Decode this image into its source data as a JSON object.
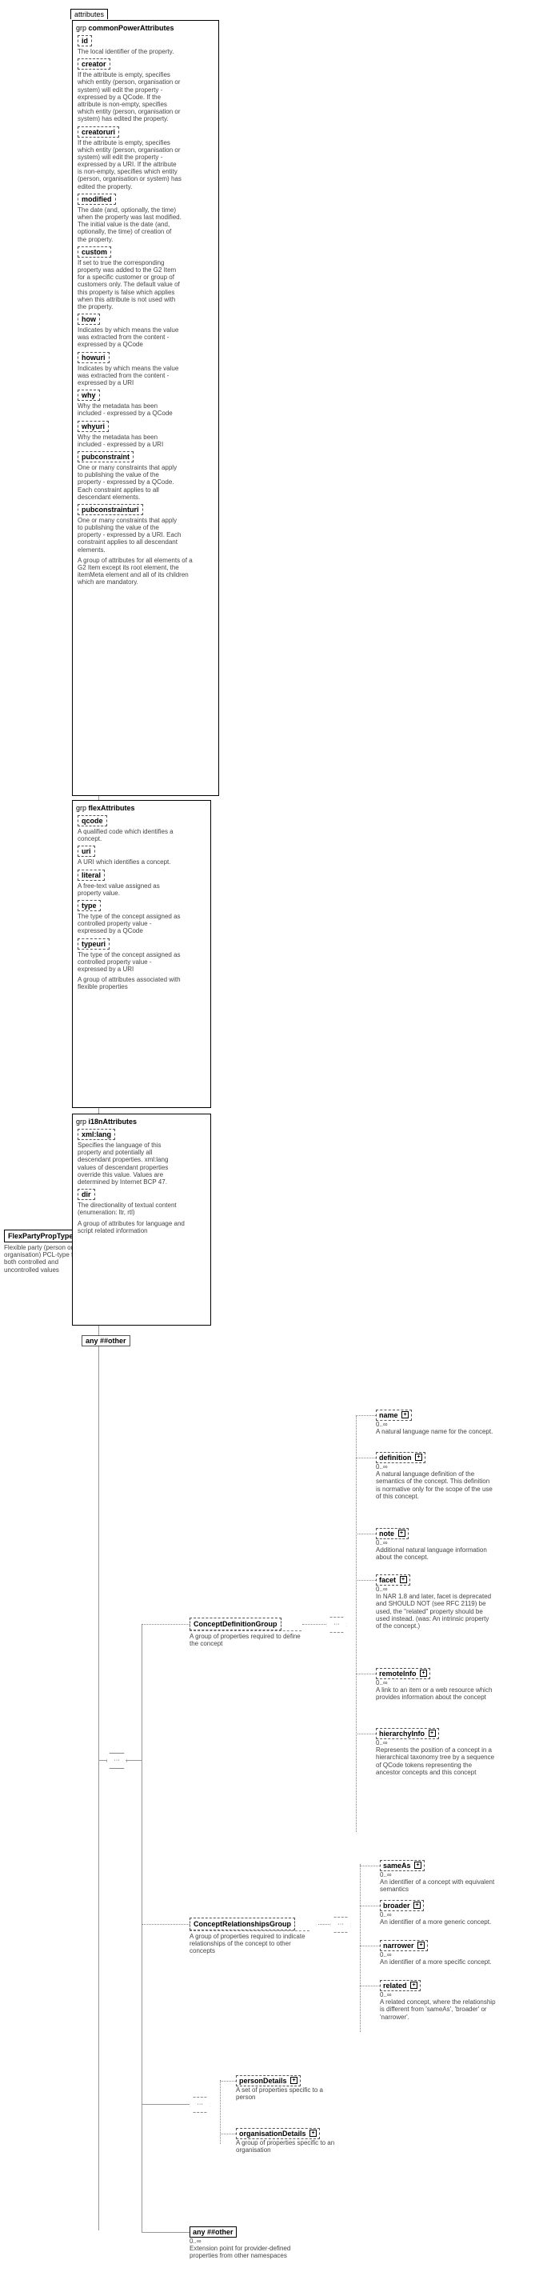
{
  "root": {
    "label": "FlexPartyPropType",
    "desc": "Flexible party (person or organisation) PCL-type for both controlled and uncontrolled values"
  },
  "attributes_tab": "attributes",
  "grp_prefix": "grp",
  "common": {
    "title": "commonPowerAttributes",
    "items": [
      {
        "name": "id",
        "desc": "The local identifier of the property."
      },
      {
        "name": "creator",
        "desc": "If the attribute is empty, specifies which entity (person, organisation or system) will edit the property - expressed by a QCode. If the attribute is non-empty, specifies which entity (person, organisation or system) has edited the property."
      },
      {
        "name": "creatoruri",
        "desc": "If the attribute is empty, specifies which entity (person, organisation or system) will edit the property - expressed by a URI. If the attribute is non-empty, specifies which entity (person, organisation or system) has edited the property."
      },
      {
        "name": "modified",
        "desc": "The date (and, optionally, the time) when the property was last modified. The initial value is the date (and, optionally, the time) of creation of the property."
      },
      {
        "name": "custom",
        "desc": "If set to true the corresponding property was added to the G2 Item for a specific customer or group of customers only. The default value of this property is false which applies when this attribute is not used with the property."
      },
      {
        "name": "how",
        "desc": "Indicates by which means the value was extracted from the content - expressed by a QCode"
      },
      {
        "name": "howuri",
        "desc": "Indicates by which means the value was extracted from the content - expressed by a URI"
      },
      {
        "name": "why",
        "desc": "Why the metadata has been included - expressed by a QCode"
      },
      {
        "name": "whyuri",
        "desc": "Why the metadata has been included - expressed by a URI"
      },
      {
        "name": "pubconstraint",
        "desc": "One or many constraints that apply to publishing the value of the property - expressed by a QCode. Each constraint applies to all descendant elements."
      },
      {
        "name": "pubconstrainturi",
        "desc": "One or many constraints that apply to publishing the value of the property - expressed by a URI. Each constraint applies to all descendant elements."
      }
    ],
    "desc": "A group of attributes for all elements of a G2 Item except its root element, the itemMeta element and all of its children which are mandatory."
  },
  "flex": {
    "title": "flexAttributes",
    "items": [
      {
        "name": "qcode",
        "desc": "A qualified code which identifies a concept."
      },
      {
        "name": "uri",
        "desc": "A URI which identifies a concept."
      },
      {
        "name": "literal",
        "desc": "A free-text value assigned as property value."
      },
      {
        "name": "type",
        "desc": "The type of the concept assigned as controlled property value - expressed by a QCode"
      },
      {
        "name": "typeuri",
        "desc": "The type of the concept assigned as controlled property value - expressed by a URI"
      }
    ],
    "desc": "A group of attributes associated with flexible properties"
  },
  "i18n": {
    "title": "i18nAttributes",
    "items": [
      {
        "name": "xml:lang",
        "desc": "Specifies the language of this property and potentially all descendant properties. xml:lang values of descendant properties override this value. Values are determined by Internet BCP 47."
      },
      {
        "name": "dir",
        "desc": "The directionality of textual content (enumeration: ltr, rtl)"
      }
    ],
    "desc": "A group of attributes for language and script related information"
  },
  "any_other": "any ##other",
  "defGroup": {
    "label": "ConceptDefinitionGroup",
    "desc": "A group of properties required to define the concept",
    "children": [
      {
        "name": "name",
        "desc": "A natural language name for the concept."
      },
      {
        "name": "definition",
        "desc": "A natural language definition of the semantics of the concept. This definition is normative only for the scope of the use of this concept."
      },
      {
        "name": "note",
        "desc": "Additional natural language information about the concept."
      },
      {
        "name": "facet",
        "desc": "In NAR 1.8 and later, facet is deprecated and SHOULD NOT (see RFC 2119) be used, the \"related\" property should be used instead. (was: An intrinsic property of the concept.)"
      },
      {
        "name": "remoteInfo",
        "desc": "A link to an item or a web resource which provides information about the concept"
      },
      {
        "name": "hierarchyInfo",
        "desc": "Represents the position of a concept in a hierarchical taxonomy tree by a sequence of QCode tokens representing the ancestor concepts and this concept"
      }
    ]
  },
  "relGroup": {
    "label": "ConceptRelationshipsGroup",
    "desc": "A group of properties required to indicate relationships of the concept to other concepts",
    "children": [
      {
        "name": "sameAs",
        "desc": "An identifier of a concept with equivalent semantics"
      },
      {
        "name": "broader",
        "desc": "An identifier of a more generic concept."
      },
      {
        "name": "narrower",
        "desc": "An identifier of a more specific concept."
      },
      {
        "name": "related",
        "desc": "A related concept, where the relationship is different from 'sameAs', 'broader' or 'narrower'."
      }
    ]
  },
  "choice": {
    "items": [
      {
        "name": "personDetails",
        "desc": "A set of properties specific to a person"
      },
      {
        "name": "organisationDetails",
        "desc": "A group of properties specific to an organisation"
      }
    ],
    "desc": "A group of properties specific to an organisation"
  },
  "anyBottom": {
    "label": "any ##other",
    "card": "0..∞",
    "desc": "Extension point for provider-defined properties from other namespaces"
  }
}
